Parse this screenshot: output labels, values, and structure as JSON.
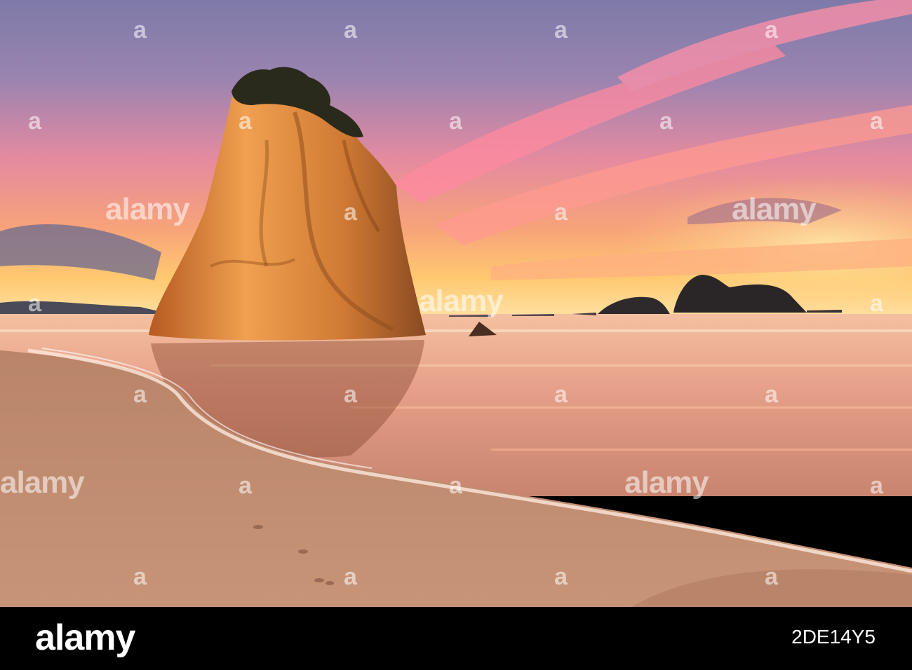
{
  "scene": {
    "description_colors": {
      "sky_top": "#8a7ca8",
      "sky_mid": "#f08a7a",
      "horizon": "#ffc46a",
      "sea": "#e89a7a",
      "sand": "#c08a6c",
      "rock_lit": "#e08a3a",
      "rock_shadow": "#7a4020"
    }
  },
  "watermarks": {
    "word": "alamy",
    "letter": "a"
  },
  "footer": {
    "logo": "alamy",
    "image_id": "2DE14Y5"
  }
}
